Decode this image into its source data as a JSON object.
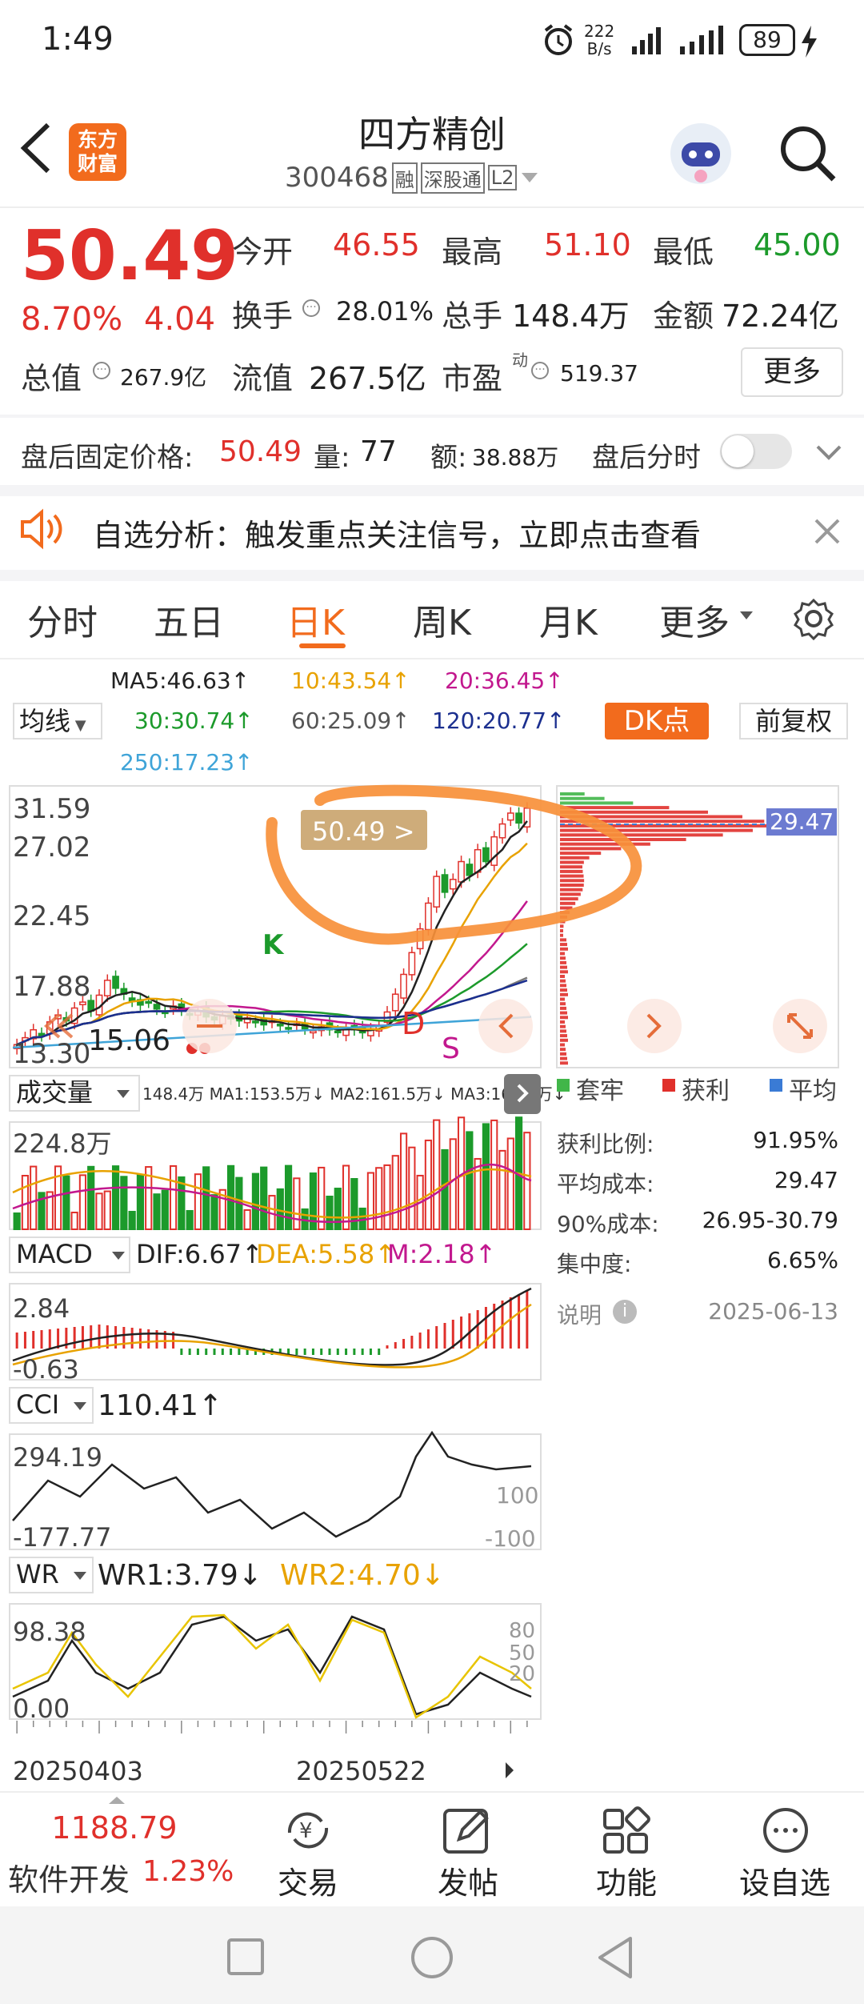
{
  "status": {
    "time": "1:49",
    "net_speed_top": "222",
    "net_speed_bottom": "B/s",
    "battery": "89"
  },
  "header": {
    "title": "四方精创",
    "code": "300468",
    "tag1": "融",
    "tag2": "深股通",
    "tag3": "L2",
    "logo_line1": "东方",
    "logo_line2": "财富"
  },
  "quote": {
    "price": "50.49",
    "change_pct": "8.70%",
    "change": "4.04",
    "open_label": "今开",
    "open": "46.55",
    "high_label": "最高",
    "high": "51.10",
    "low_label": "最低",
    "low": "45.00",
    "turnover_label": "换手",
    "turnover": "28.01%",
    "volume_label": "总手",
    "volume": "148.4万",
    "amount_label": "金额",
    "amount": "72.24亿",
    "mktcap_label": "总值",
    "mktcap": "267.9亿",
    "float_label": "流值",
    "float": "267.5亿",
    "pe_label": "市盈",
    "pe_sup": "动",
    "pe": "519.37",
    "more_button": "更多"
  },
  "after_hours": {
    "price_label": "盘后固定价格:",
    "price": "50.49",
    "vol_label": "量:",
    "vol": "77",
    "amt_label": "额:",
    "amt": "38.88万",
    "timeshare_label": "盘后分时"
  },
  "alert": {
    "text": "自选分析：触发重点关注信号，立即点击查看"
  },
  "tabs": [
    "分时",
    "五日",
    "日K",
    "周K",
    "月K",
    "更多"
  ],
  "active_tab": "日K",
  "ma": {
    "selector": "均线",
    "ma5": "MA5:46.63↑",
    "ma10": "10:43.54↑",
    "ma20": "20:36.45↑",
    "ma30": "30:30.74↑",
    "ma60": "60:25.09↑",
    "ma120": "120:20.77↑",
    "ma250": "250:17.23↑",
    "dk_button": "DK点",
    "adjust_button": "前复权"
  },
  "kchart": {
    "y_labels": [
      "31.59",
      "27.02",
      "22.45",
      "17.88",
      "13.30"
    ],
    "price_tag": "50.49 >",
    "low_marker": "15.06",
    "cost_tag": "29.47",
    "markers": {
      "k": "K",
      "d": "D",
      "s": "S"
    }
  },
  "volume": {
    "selector": "成交量",
    "legend": "148.4万 MA1:153.5万↓ MA2:161.5万↓ MA3:162.1万↓",
    "y_label": "224.8万"
  },
  "macd": {
    "selector": "MACD",
    "dif": "DIF:6.67↑",
    "dea": "DEA:5.58↑",
    "m": "M:2.18↑",
    "y_top": "2.84",
    "y_bottom": "-0.63"
  },
  "cci": {
    "selector": "CCI",
    "value": "110.41↑",
    "y_top": "294.19",
    "y_bottom": "-177.77",
    "ref_top": "100",
    "ref_bottom": "-100"
  },
  "wr": {
    "selector": "WR",
    "wr1": "WR1:3.79↓",
    "wr2": "WR2:4.70↓",
    "y_top": "98.38",
    "y_bottom": "0.00",
    "ref1": "80",
    "ref2": "50",
    "ref3": "20"
  },
  "dates": {
    "left": "20250403",
    "mid": "20250522"
  },
  "chips": {
    "legend_trapped": "套牢",
    "legend_profit": "获利",
    "legend_avg": "平均",
    "profit_ratio_label": "获利比例:",
    "profit_ratio": "91.95%",
    "avg_cost_label": "平均成本:",
    "avg_cost": "29.47",
    "cost90_label": "90%成本:",
    "cost90": "26.95-30.79",
    "concentration_label": "集中度:",
    "concentration": "6.65%",
    "note_label": "说明",
    "date": "2025-06-13"
  },
  "bottom_bar": {
    "index_value": "1188.79",
    "index_name": "软件开发",
    "index_change": "1.23%",
    "trade": "交易",
    "post": "发帖",
    "func": "功能",
    "watch": "设自选"
  },
  "colors": {
    "up": "#e0302b",
    "down": "#1c9a2b",
    "accent": "#f26b1d",
    "annotation": "#f7903a"
  }
}
